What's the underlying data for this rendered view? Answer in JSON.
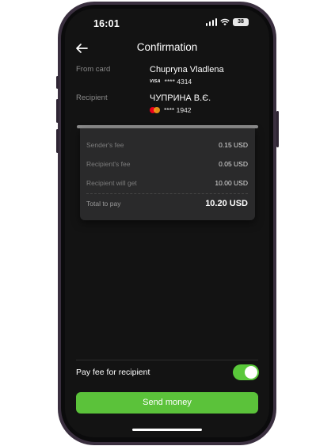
{
  "status_bar": {
    "time": "16:01",
    "battery": "38"
  },
  "header": {
    "back_icon": "arrow-left-icon",
    "title": "Confirmation"
  },
  "from_card": {
    "label": "From card",
    "name": "Chupryna Vladlena",
    "network": "VISA",
    "masked_number": "**** 4314"
  },
  "recipient": {
    "label": "Recipient",
    "name": "ЧУПРИНА В.Є.",
    "network_icon": "mastercard-icon",
    "masked_number": "**** 1942"
  },
  "fees": {
    "rows": [
      {
        "label": "Sender's fee",
        "value": "0.15 USD"
      },
      {
        "label": "Recipient's fee",
        "value": "0.05 USD"
      },
      {
        "label": "Recipient will get",
        "value": "10.00 USD"
      }
    ],
    "total": {
      "label": "Total to pay",
      "value": "10.20 USD"
    }
  },
  "pay_fee_toggle": {
    "label": "Pay fee for recipient",
    "on": true
  },
  "send_button": {
    "label": "Send money"
  },
  "colors": {
    "accent": "#5bc23a",
    "background": "#131313",
    "card": "#2a2a2b"
  }
}
